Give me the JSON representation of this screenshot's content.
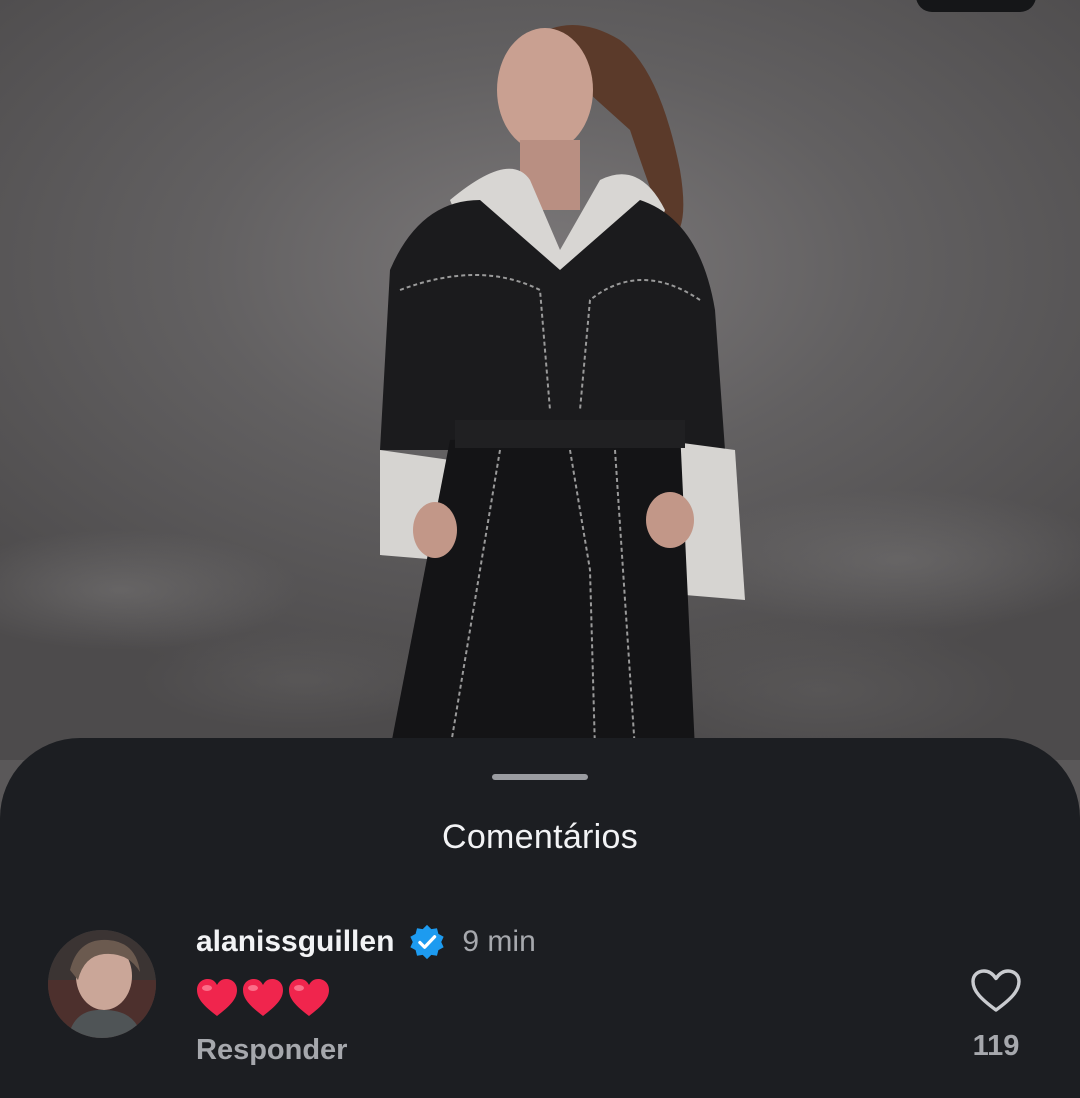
{
  "sheet": {
    "title": "Comentários"
  },
  "comment": {
    "username": "alanissguillen",
    "timestamp": "9 min",
    "text": "❤❤❤",
    "reply_label": "Responder",
    "like_count": "119",
    "verified_icon": "verified-badge-icon",
    "like_icon": "heart-outline-icon"
  },
  "colors": {
    "sheet_bg": "#1c1e22",
    "verified": "#1d9bf0",
    "heart_emoji": "#f0254d",
    "muted_text": "#a6a8ad"
  }
}
